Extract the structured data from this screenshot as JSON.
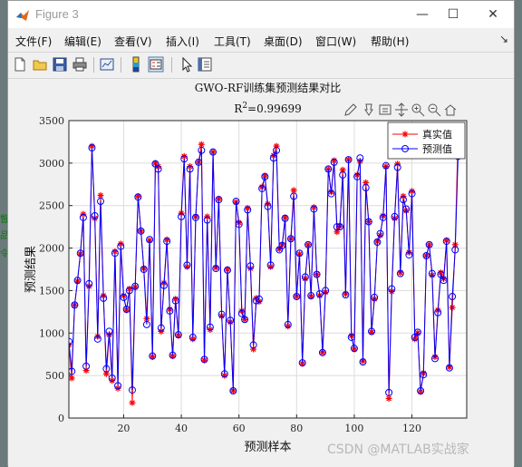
{
  "window": {
    "title": "Figure 3",
    "min": "—",
    "max": "☐",
    "close": "✕"
  },
  "menus": [
    "文件(F)",
    "编辑(E)",
    "查看(V)",
    "插入(I)",
    "工具(T)",
    "桌面(D)",
    "窗口(W)",
    "帮助(H)"
  ],
  "menu_overflow": "↘",
  "toolbar_icons": [
    "new-figure-icon",
    "open-file-icon",
    "save-icon",
    "print-icon",
    "link-plot-icon",
    "insert-colorbar-icon",
    "insert-legend-icon",
    "pointer-icon",
    "property-inspector-icon"
  ],
  "axes_toolbar_icons": [
    "brush-edit-icon",
    "data-tips-icon",
    "save-export-icon",
    "pan-icon",
    "zoom-in-icon",
    "zoom-out-icon",
    "home-icon"
  ],
  "watermark": "CSDN @MATLAB实战家",
  "colors": {
    "true_series": "#ff0000",
    "pred_series": "#0000ff"
  },
  "chart_data": {
    "type": "line",
    "title": "GWO-RF训练集预测结果对比",
    "subtitle_prefix": "R",
    "subtitle_sup": "2",
    "subtitle_value": "=0.99699",
    "xlabel": "预测样本",
    "ylabel": "预测结果",
    "xlim": [
      1,
      139
    ],
    "ylim": [
      0,
      3500
    ],
    "xticks": [
      20,
      40,
      60,
      80,
      100,
      120
    ],
    "yticks": [
      0,
      500,
      1000,
      1500,
      2000,
      2500,
      3000,
      3500
    ],
    "grid": true,
    "legend_position": "top-right",
    "series": [
      {
        "name": "真实值",
        "marker": "asterisk",
        "values": [
          860,
          470,
          1330,
          1610,
          1930,
          2400,
          560,
          1550,
          3200,
          2350,
          960,
          2620,
          1440,
          520,
          980,
          440,
          1960,
          350,
          2050,
          1440,
          1270,
          1520,
          180,
          1540,
          2610,
          2200,
          1760,
          1170,
          2090,
          720,
          3000,
          2960,
          1020,
          1590,
          2100,
          1280,
          730,
          1400,
          970,
          2410,
          3080,
          1780,
          2960,
          930,
          2370,
          3010,
          3220,
          680,
          2370,
          1040,
          3130,
          1770,
          2580,
          1200,
          500,
          1750,
          1130,
          320,
          2540,
          2300,
          1260,
          1160,
          2470,
          1760,
          810,
          1410,
          1370,
          2720,
          2850,
          2520,
          1780,
          3090,
          3200,
          1990,
          2040,
          2360,
          1080,
          2110,
          2680,
          1430,
          1930,
          640,
          1640,
          2040,
          1430,
          2480,
          1690,
          1440,
          770,
          1480,
          2930,
          2660,
          3030,
          2190,
          2260,
          2920,
          1460,
          3040,
          970,
          810,
          2860,
          3020,
          670,
          2770,
          2310,
          1010,
          1400,
          2080,
          2150,
          2380,
          2960,
          230,
          1490,
          2350,
          2990,
          1710,
          2610,
          2440,
          1950,
          2670,
          930,
          1000,
          310,
          530,
          1910,
          2040,
          1680,
          720,
          1270,
          1710,
          1640,
          2090,
          600,
          1300,
          2040,
          3330
        ]
      },
      {
        "name": "预测值",
        "marker": "circle",
        "values": [
          900,
          550,
          1330,
          1620,
          1940,
          2360,
          610,
          1580,
          3180,
          2380,
          930,
          2550,
          1410,
          580,
          1020,
          470,
          1940,
          380,
          2020,
          1420,
          1280,
          1500,
          330,
          1550,
          2600,
          2200,
          1750,
          1100,
          2100,
          730,
          2990,
          2930,
          1060,
          1560,
          2080,
          1260,
          740,
          1380,
          980,
          2370,
          3050,
          1800,
          2930,
          950,
          2360,
          3010,
          3150,
          690,
          2330,
          1070,
          3130,
          1760,
          2570,
          1220,
          520,
          1740,
          1150,
          320,
          2550,
          2280,
          1230,
          1160,
          2450,
          1790,
          860,
          1380,
          1400,
          2700,
          2840,
          2490,
          1800,
          3060,
          3150,
          1980,
          2030,
          2350,
          1100,
          2110,
          2610,
          1430,
          1940,
          650,
          1660,
          2040,
          1440,
          2460,
          1690,
          1460,
          770,
          1500,
          2930,
          2640,
          3010,
          2250,
          2250,
          2860,
          1450,
          3040,
          950,
          820,
          2840,
          3060,
          660,
          2710,
          2310,
          1020,
          1420,
          2070,
          2170,
          2360,
          2970,
          300,
          1520,
          2370,
          2950,
          1700,
          2570,
          2460,
          1920,
          2640,
          950,
          1010,
          320,
          510,
          1910,
          2040,
          1700,
          700,
          1240,
          1690,
          1620,
          2080,
          590,
          1430,
          1980,
          3080
        ]
      }
    ]
  }
}
